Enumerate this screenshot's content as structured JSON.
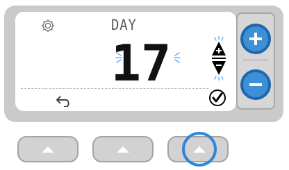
{
  "display": {
    "mode_label": "DAY",
    "day_value": "17"
  },
  "icons": {
    "settings": "gear-icon",
    "back": "back-arrow-icon",
    "adjust": "up-down-arrows-icon",
    "confirm": "check-circle-icon",
    "increase": "plus-icon",
    "decrease": "minus-icon",
    "soft_key": "up-triangle-icon"
  },
  "colors": {
    "accent": "#3d8fd6",
    "accent_border": "#1f67ad",
    "glow": "#63b4ff",
    "body": "#c9cacb",
    "lcd_text": "#111111"
  },
  "highlighted_controls": [
    "plus",
    "minus",
    "soft-key-3"
  ]
}
